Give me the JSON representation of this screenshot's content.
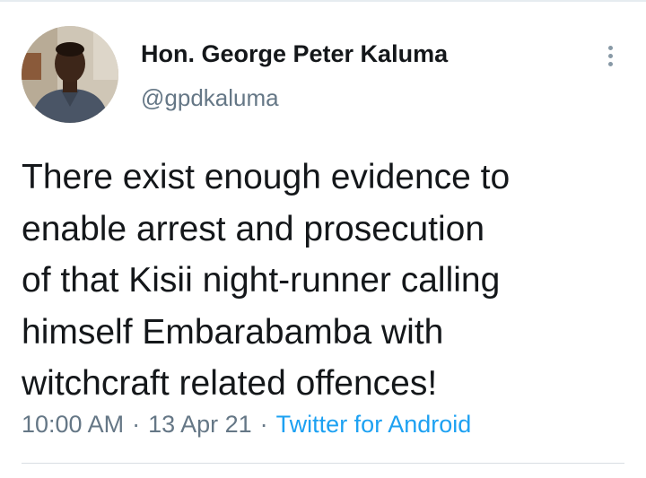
{
  "author": {
    "display_name": "Hon. George Peter Kaluma",
    "handle": "@gpdkaluma",
    "avatar_icon": "profile-photo"
  },
  "tweet": {
    "text_lines": [
      "There exist enough evidence to",
      "enable arrest and prosecution",
      "of that Kisii night-runner calling",
      "himself Embarabamba with",
      "witchcraft related offences!"
    ],
    "time": "10:00 AM",
    "date": "13 Apr 21",
    "separator": "·",
    "source": "Twitter for Android"
  },
  "actions": {
    "more_icon": "more-vertical-icon"
  },
  "colors": {
    "text_primary": "#14171a",
    "text_secondary": "#657786",
    "link": "#1da1f2",
    "divider": "#d8dee3"
  }
}
